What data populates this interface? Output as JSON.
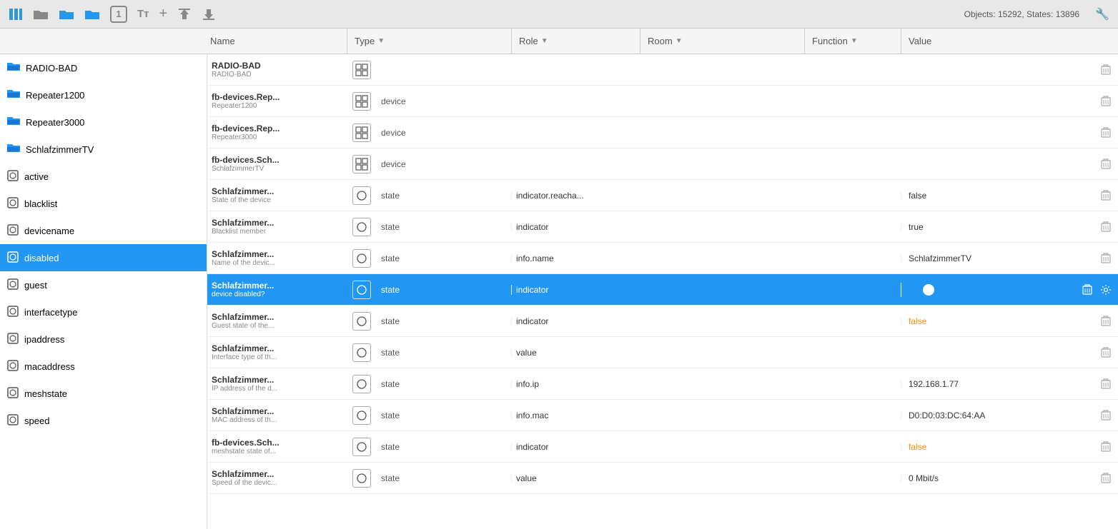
{
  "topbar": {
    "objects_label": "Objects: 15292, States: 13896",
    "icons": [
      {
        "name": "columns-icon",
        "glyph": "▦"
      },
      {
        "name": "folder-icon",
        "glyph": "📁"
      },
      {
        "name": "folder-open-icon",
        "glyph": "📂"
      },
      {
        "name": "folder-new-icon",
        "glyph": "📁"
      },
      {
        "name": "badge-1-icon",
        "glyph": "①"
      },
      {
        "name": "text-icon",
        "glyph": "Tт"
      },
      {
        "name": "add-icon",
        "glyph": "+"
      },
      {
        "name": "upload-icon",
        "glyph": "↑"
      },
      {
        "name": "download-icon",
        "glyph": "↓"
      }
    ]
  },
  "columns": {
    "name": "Name",
    "type": "Type",
    "role": "Role",
    "room": "Room",
    "function": "Function",
    "value": "Value"
  },
  "sidebar": {
    "items": [
      {
        "id": "radio-bad",
        "label": "RADIO-BAD",
        "type": "folder-open",
        "selected": false
      },
      {
        "id": "repeater1200",
        "label": "Repeater1200",
        "type": "folder-open",
        "selected": false
      },
      {
        "id": "repeater3000",
        "label": "Repeater3000",
        "type": "folder-open",
        "selected": false
      },
      {
        "id": "schlafzimmertv",
        "label": "SchlafzimmerTV",
        "type": "folder-open",
        "selected": false
      },
      {
        "id": "active",
        "label": "active",
        "type": "state",
        "selected": false
      },
      {
        "id": "blacklist",
        "label": "blacklist",
        "type": "state",
        "selected": false
      },
      {
        "id": "devicename",
        "label": "devicename",
        "type": "state",
        "selected": false
      },
      {
        "id": "disabled",
        "label": "disabled",
        "type": "state",
        "selected": true
      },
      {
        "id": "guest",
        "label": "guest",
        "type": "state",
        "selected": false
      },
      {
        "id": "interfacetype",
        "label": "interfacetype",
        "type": "state",
        "selected": false
      },
      {
        "id": "ipaddress",
        "label": "ipaddress",
        "type": "state",
        "selected": false
      },
      {
        "id": "macaddress",
        "label": "macaddress",
        "type": "state",
        "selected": false
      },
      {
        "id": "meshstate",
        "label": "meshstate",
        "type": "state",
        "selected": false
      },
      {
        "id": "speed",
        "label": "speed",
        "type": "state",
        "selected": false
      }
    ]
  },
  "rows": [
    {
      "id": "row-radio-bad",
      "name_main": "RADIO-BAD",
      "name_sub": "RADIO-BAD",
      "type_icon": "device",
      "type_label": "",
      "role": "",
      "room": "",
      "function": "",
      "value": "",
      "value_class": "",
      "has_toggle": false,
      "has_actions": true,
      "selected": false
    },
    {
      "id": "row-rep1200",
      "name_main": "fb-devices.Rep...",
      "name_sub": "Repeater1200",
      "type_icon": "device",
      "type_label": "device",
      "role": "",
      "room": "",
      "function": "",
      "value": "",
      "value_class": "",
      "has_toggle": false,
      "has_actions": true,
      "selected": false
    },
    {
      "id": "row-rep3000",
      "name_main": "fb-devices.Rep...",
      "name_sub": "Repeater3000",
      "type_icon": "device",
      "type_label": "device",
      "role": "",
      "room": "",
      "function": "",
      "value": "",
      "value_class": "",
      "has_toggle": false,
      "has_actions": true,
      "selected": false
    },
    {
      "id": "row-schlaf-device",
      "name_main": "fb-devices.Sch...",
      "name_sub": "SchlafzimmerTV",
      "type_icon": "device",
      "type_label": "device",
      "role": "",
      "room": "",
      "function": "",
      "value": "",
      "value_class": "",
      "has_toggle": false,
      "has_actions": true,
      "selected": false
    },
    {
      "id": "row-active",
      "name_main": "Schlafzimmer...",
      "name_sub": "State of the device",
      "type_icon": "state",
      "type_label": "state",
      "role": "indicator.reacha...",
      "room": "",
      "function": "",
      "value": "false",
      "value_class": "",
      "has_toggle": false,
      "has_actions": true,
      "selected": false
    },
    {
      "id": "row-blacklist",
      "name_main": "Schlafzimmer...",
      "name_sub": "Blacklist member",
      "type_icon": "state",
      "type_label": "state",
      "role": "indicator",
      "room": "",
      "function": "",
      "value": "true",
      "value_class": "",
      "has_toggle": false,
      "has_actions": true,
      "selected": false
    },
    {
      "id": "row-devicename",
      "name_main": "Schlafzimmer...",
      "name_sub": "Name of the devic...",
      "type_icon": "state",
      "type_label": "state",
      "role": "info.name",
      "room": "",
      "function": "",
      "value": "SchlafzimmerTV",
      "value_class": "",
      "has_toggle": false,
      "has_actions": true,
      "selected": false
    },
    {
      "id": "row-disabled",
      "name_main": "Schlafzimmer...",
      "name_sub": "device disabled?",
      "type_icon": "state",
      "type_label": "state",
      "role": "indicator",
      "room": "",
      "function": "",
      "value": "",
      "value_class": "",
      "has_toggle": true,
      "has_actions": true,
      "selected": true
    },
    {
      "id": "row-guest",
      "name_main": "Schlafzimmer...",
      "name_sub": "Guest state of the...",
      "type_icon": "state",
      "type_label": "state",
      "role": "indicator",
      "room": "",
      "function": "",
      "value": "false",
      "value_class": "val-orange",
      "has_toggle": false,
      "has_actions": true,
      "selected": false
    },
    {
      "id": "row-interfacetype",
      "name_main": "Schlafzimmer...",
      "name_sub": "Interface type of th...",
      "type_icon": "state",
      "type_label": "state",
      "role": "value",
      "room": "",
      "function": "",
      "value": "",
      "value_class": "",
      "has_toggle": false,
      "has_actions": true,
      "selected": false
    },
    {
      "id": "row-ipaddress",
      "name_main": "Schlafzimmer...",
      "name_sub": "IP address of the d...",
      "type_icon": "state",
      "type_label": "state",
      "role": "info.ip",
      "room": "",
      "function": "",
      "value": "192.168.1.77",
      "value_class": "",
      "has_toggle": false,
      "has_actions": true,
      "selected": false
    },
    {
      "id": "row-macaddress",
      "name_main": "Schlafzimmer...",
      "name_sub": "MAC address of th...",
      "type_icon": "state",
      "type_label": "state",
      "role": "info.mac",
      "room": "",
      "function": "",
      "value": "D0:D0:03:DC:64:AA",
      "value_class": "",
      "has_toggle": false,
      "has_actions": true,
      "selected": false
    },
    {
      "id": "row-meshstate",
      "name_main": "fb-devices.Sch...",
      "name_sub": "meshstate state of...",
      "type_icon": "state",
      "type_label": "state",
      "role": "indicator",
      "room": "",
      "function": "",
      "value": "false",
      "value_class": "val-orange",
      "has_toggle": false,
      "has_actions": true,
      "selected": false
    },
    {
      "id": "row-speed",
      "name_main": "Schlafzimmer...",
      "name_sub": "Speed of the devic...",
      "type_icon": "state",
      "type_label": "state",
      "role": "value",
      "room": "",
      "function": "",
      "value": "0 Mbit/s",
      "value_class": "",
      "has_toggle": false,
      "has_actions": true,
      "selected": false
    }
  ]
}
